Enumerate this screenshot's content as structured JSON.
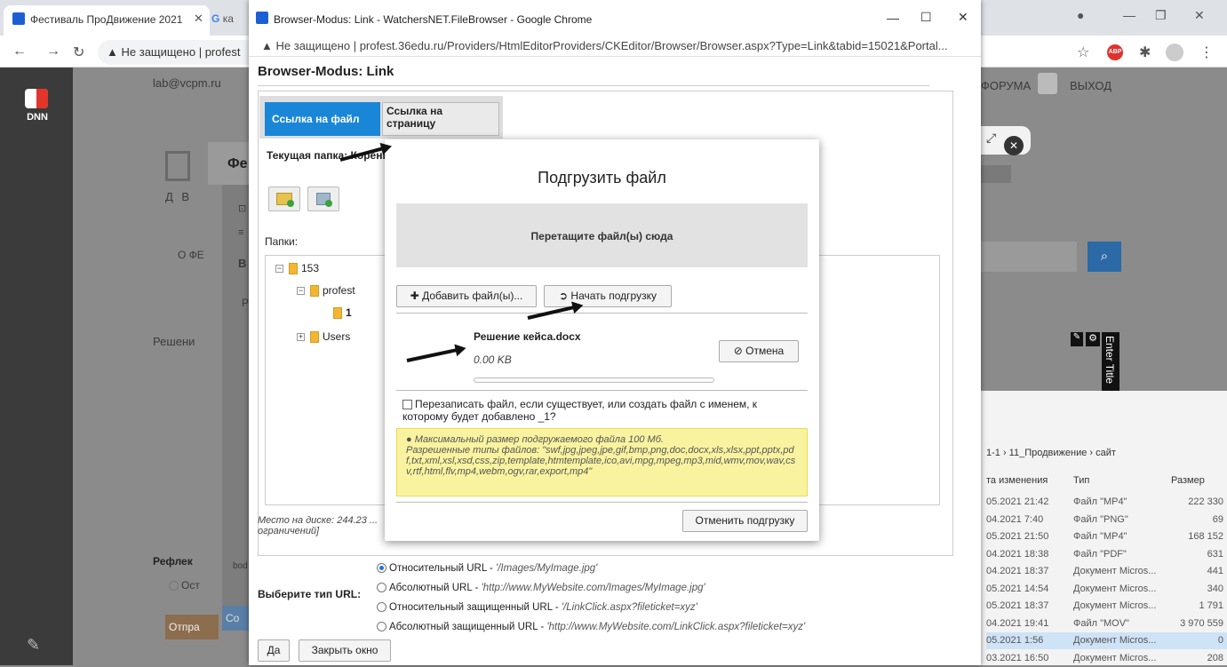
{
  "bg_browser": {
    "tab1_title": "Фестиваль ПроДвижение 2021",
    "tab2_title": "ка",
    "omnibox_insecure": "Не защищено",
    "omnibox_host": "profest",
    "user_label": "lab@vcpm.ru",
    "nav_forum": "ФОРУМА",
    "nav_logout": "ВЫХОД",
    "side_text_1": "Фе",
    "side_text_2": "Д В",
    "side_text_3": "О ФЕ",
    "side_text_4": "Решени",
    "side_text_5": "Рефлек",
    "side_text_6": "Ост",
    "side_text_7": "Отпра",
    "side_text_8": "Со",
    "side_text_9": "bod",
    "b_label": "B",
    "p_label": "Р",
    "enter_title": "Enter Title",
    "az_label": "az"
  },
  "file_list": {
    "breadcrumb": "1-1  ›  11_Продвижение  ›  сайт",
    "headers": [
      "та изменения",
      "Тип",
      "Размер"
    ],
    "rows": [
      [
        "05.2021 21:42",
        "Файл \"MP4\"",
        "222 330"
      ],
      [
        "04.2021 7:40",
        "Файл \"PNG\"",
        "69"
      ],
      [
        "05.2021 21:50",
        "Файл \"MP4\"",
        "168 152"
      ],
      [
        "04.2021 18:38",
        "Файл \"PDF\"",
        "631"
      ],
      [
        "04.2021 18:37",
        "Документ Micros...",
        "441"
      ],
      [
        "05.2021 14:54",
        "Документ Micros...",
        "340"
      ],
      [
        "05.2021 18:37",
        "Документ Micros...",
        "1 791"
      ],
      [
        "04.2021 19:41",
        "Файл \"MOV\"",
        "3 970 559"
      ],
      [
        "05.2021 1:56",
        "Документ Micros...",
        "0"
      ],
      [
        "03.2021 16:50",
        "Документ Micros...",
        "208"
      ]
    ]
  },
  "popup": {
    "window_title": "Browser-Modus: Link - WatchersNET.FileBrowser - Google Chrome",
    "insecure": "Не защищено",
    "url": "profest.36edu.ru/Providers/HtmlEditorProviders/CKEditor/Browser/Browser.aspx?Type=Link&tabid=15021&Portal...",
    "heading": "Browser-Modus: Link",
    "tab_file": "Ссылка на файл",
    "tab_page_1": "Ссылка на",
    "tab_page_2": "страницу",
    "current_folder": "Текущая папка: Корень",
    "folders_label": "Папки:",
    "tree": [
      {
        "label": "153"
      },
      {
        "label": "profest"
      },
      {
        "label": "1"
      },
      {
        "label": "Users"
      }
    ],
    "disk_info": "Место на диске: 244.23 ... ограничений]",
    "url_type_label": "Выберите тип URL:",
    "url_options": [
      {
        "label": "Относительный URL - ",
        "example": "'/Images/MyImage.jpg'"
      },
      {
        "label": "Абсолютный URL - ",
        "example": "'http://www.MyWebsite.com/Images/MyImage.jpg'"
      },
      {
        "label": "Относительный защищенный URL - ",
        "example": "'/LinkClick.aspx?fileticket=xyz'"
      },
      {
        "label": "Абсолютный защищенный URL - ",
        "example": "'http://www.MyWebsite.com/LinkClick.aspx?fileticket=xyz'"
      }
    ],
    "ok_button": "Да",
    "close_button": "Закрыть окно"
  },
  "upload": {
    "title": "Подгрузить файл",
    "drop_text": "Перетащите файл(ы) сюда",
    "add_files": "Добавить файл(ы)...",
    "start_upload": "Начать подгрузку",
    "file_name": "Решение кейса.docx",
    "file_size": "0.00 KB",
    "progress": 0,
    "cancel": "Отмена",
    "overwrite_text": "Перезаписать файл, если существует, или создать файл с именем, к которому будет добавлено _1?",
    "info_line1": "Максимальный размер подгружаемого файла 100 Мб.",
    "info_line2": "Разрешенные типы файлов: \"swf,jpg,jpeg,jpe,gif,bmp,png,doc,docx,xls,xlsx,ppt,pptx,pdf,txt,xml,xsl,xsd,css,zip,template,htmtemplate,ico,avi,mpg,mpeg,mp3,mid,wmv,mov,wav,csv,rtf,html,flv,mp4,webm,ogv,rar,export,mp4\"",
    "cancel_upload": "Отменить подгрузку"
  }
}
